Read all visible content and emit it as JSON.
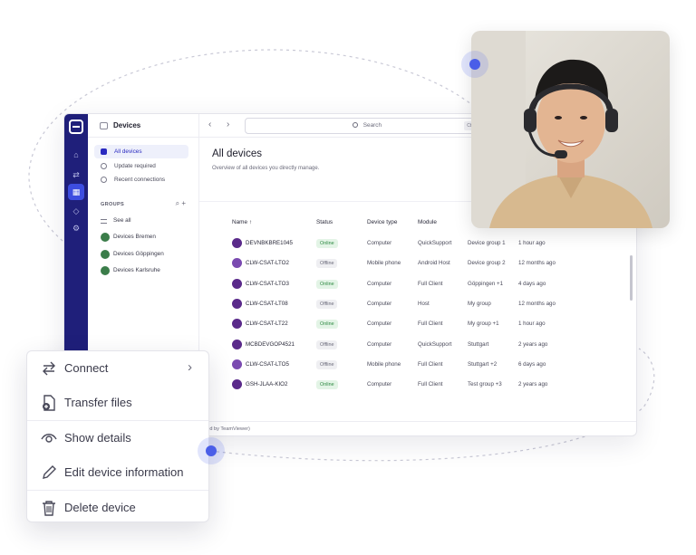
{
  "sidebar": {
    "title": "Devices",
    "nav": [
      {
        "label": "All devices"
      },
      {
        "label": "Update required"
      },
      {
        "label": "Recent connections"
      }
    ],
    "groups_label": "GROUPS",
    "groups_tools": "⌕ +",
    "groups": [
      {
        "label": "See all"
      },
      {
        "label": "Devices Bremen"
      },
      {
        "label": "Devices Göppingen"
      },
      {
        "label": "Devices Karlsruhe"
      }
    ]
  },
  "topbar": {
    "search_placeholder": "Search",
    "search_shortcut": "Ctrl + K"
  },
  "content": {
    "title": "All devices",
    "subtitle": "Overview of all devices you directly manage.",
    "columns": [
      "Name ↑",
      "Status",
      "Device type",
      "Module"
    ],
    "rows": [
      {
        "name": "DEVNBKBRE1045",
        "status": "Online",
        "type": "Computer",
        "module": "QuickSupport",
        "group": "Device group 1",
        "last": "1 hour ago"
      },
      {
        "name": "CLW-CSAT-LTO2",
        "status": "Offline",
        "type": "Mobile phone",
        "module": "Android Host",
        "group": "Device group 2",
        "last": "12 months ago"
      },
      {
        "name": "CLW-CSAT-LTO3",
        "status": "Online",
        "type": "Computer",
        "module": "Full Client",
        "group": "Göppingen +1",
        "last": "4 days ago"
      },
      {
        "name": "CLW-CSAT-LT08",
        "status": "Offline",
        "type": "Computer",
        "module": "Host",
        "group": "My group",
        "last": "12 months ago"
      },
      {
        "name": "CLW-CSAT-LT22",
        "status": "Online",
        "type": "Computer",
        "module": "Full Client",
        "group": "My group +1",
        "last": "1 hour ago"
      },
      {
        "name": "MCBDEVGOP4521",
        "status": "Offline",
        "type": "Computer",
        "module": "QuickSupport",
        "group": "Stuttgart",
        "last": "2 years ago"
      },
      {
        "name": "CLW-CSAT-LTO5",
        "status": "Offline",
        "type": "Mobile phone",
        "module": "Full Client",
        "group": "Stuttgart +2",
        "last": "6 days ago"
      },
      {
        "name": "GSH-JLAA-KIO2",
        "status": "Online",
        "type": "Computer",
        "module": "Full Client",
        "group": "Test group +3",
        "last": "2 years ago"
      }
    ],
    "footer": "led by TeamViewer)"
  },
  "context_menu": {
    "items": [
      {
        "label": "Connect",
        "icon": "swap-arrows-icon"
      },
      {
        "label": "Transfer files",
        "icon": "file-transfer-icon"
      },
      {
        "label": "Show details",
        "icon": "eye-icon"
      },
      {
        "label": "Edit device information",
        "icon": "pencil-icon"
      },
      {
        "label": "Delete device",
        "icon": "trash-icon"
      }
    ]
  },
  "colors": {
    "rail": "#1f1f7a",
    "accent": "#3d4de0",
    "online": "#2f8a43",
    "dot": "#4a5ee8"
  }
}
